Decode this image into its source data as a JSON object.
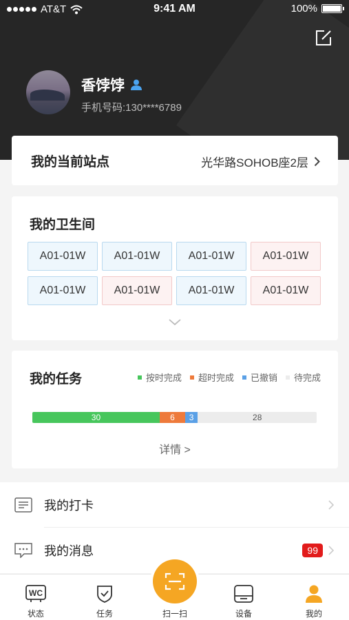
{
  "status_bar": {
    "carrier": "AT&T",
    "time": "9:41 AM",
    "battery": "100%"
  },
  "profile": {
    "name": "香饽饽",
    "phone_label": "手机号码:",
    "phone": "130****6789"
  },
  "station": {
    "title": "我的当前站点",
    "value": "光华路SOHOB座2层"
  },
  "restrooms": {
    "title": "我的卫生间",
    "items": [
      {
        "label": "A01-01W",
        "color": "blue"
      },
      {
        "label": "A01-01W",
        "color": "blue"
      },
      {
        "label": "A01-01W",
        "color": "blue"
      },
      {
        "label": "A01-01W",
        "color": "red"
      },
      {
        "label": "A01-01W",
        "color": "blue"
      },
      {
        "label": "A01-01W",
        "color": "red"
      },
      {
        "label": "A01-01W",
        "color": "blue"
      },
      {
        "label": "A01-01W",
        "color": "red"
      }
    ]
  },
  "tasks": {
    "title": "我的任务",
    "legend": [
      {
        "label": "按时完成",
        "color": "#47c65c"
      },
      {
        "label": "超时完成",
        "color": "#ee7a3b"
      },
      {
        "label": "已撤销",
        "color": "#5aa0e6"
      },
      {
        "label": "待完成",
        "color": "#ececec"
      }
    ],
    "values": {
      "ontime": "30",
      "overtime": "6",
      "cancelled": "3",
      "pending": "28"
    },
    "detail_label": "详情 >"
  },
  "menu": {
    "checkin_label": "我的打卡",
    "messages_label": "我的消息",
    "messages_badge": "99"
  },
  "tabbar": {
    "status": "状态",
    "tasks": "任务",
    "scan": "扫一扫",
    "device": "设备",
    "mine": "我的"
  },
  "colors": {
    "accent": "#f5a623",
    "header_bg": "#262626",
    "badge": "#e21b1b"
  }
}
